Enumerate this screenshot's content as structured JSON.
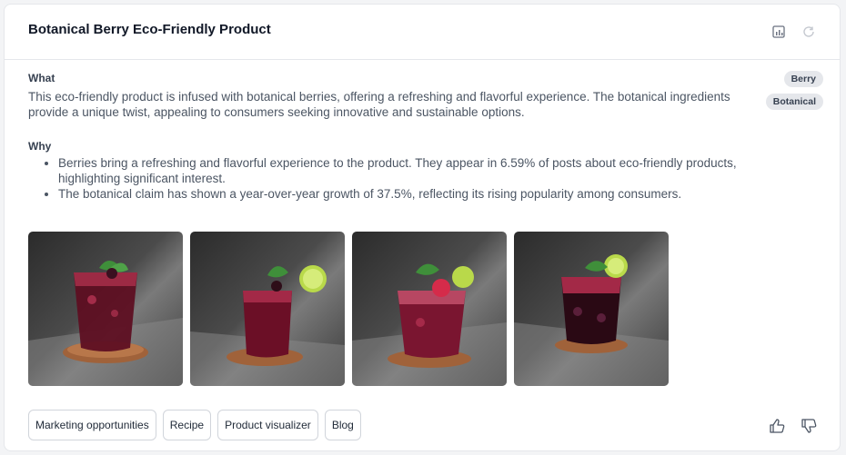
{
  "card": {
    "title": "Botanical Berry Eco-Friendly Product",
    "header_icons": [
      "chart-export-icon",
      "refresh-icon"
    ]
  },
  "what": {
    "label": "What",
    "text": "This eco-friendly product is infused with botanical berries, offering a refreshing and flavorful experience. The botanical ingredients provide a unique twist, appealing to consumers seeking innovative and sustainable options."
  },
  "why": {
    "label": "Why",
    "bullets": [
      "Berries bring a refreshing and flavorful experience to the product. They appear in 6.59% of posts about eco-friendly products, highlighting significant interest.",
      "The botanical claim has shown a year-over-year growth of 37.5%, reflecting its rising popularity among consumers."
    ]
  },
  "tags": [
    "Berry",
    "Botanical"
  ],
  "images": [
    {
      "subject": "berry drink with mint",
      "icon": "drink-image"
    },
    {
      "subject": "berry drink with lime",
      "icon": "drink-image"
    },
    {
      "subject": "berry drink with raspberry",
      "icon": "drink-image"
    },
    {
      "subject": "berry drink with lime",
      "icon": "drink-image"
    }
  ],
  "actions": [
    "Marketing opportunities",
    "Recipe",
    "Product visualizer",
    "Blog"
  ],
  "feedback": [
    "thumbs-up-icon",
    "thumbs-down-icon"
  ],
  "colors": {
    "accent": "#111827",
    "muted": "#4b5563",
    "tag_bg": "#e5e7eb",
    "drink": "#7a1530",
    "coaster": "#a0623a",
    "lime": "#b9d94a",
    "mint": "#3f8f3a"
  }
}
